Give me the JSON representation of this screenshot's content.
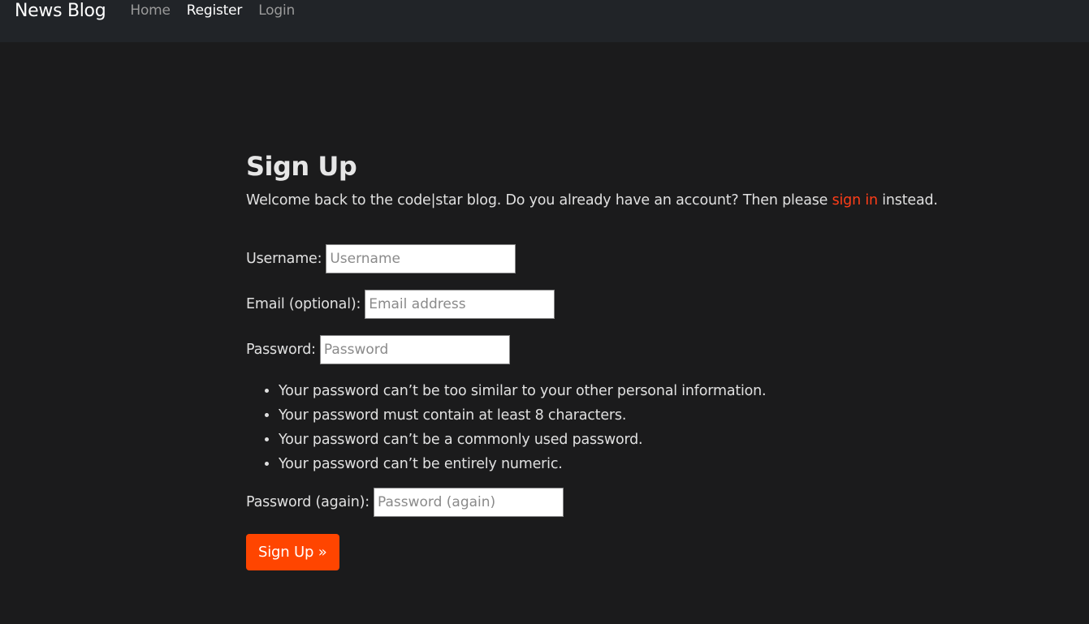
{
  "navbar": {
    "brand": "News Blog",
    "links": [
      {
        "label": "Home"
      },
      {
        "label": "Register"
      },
      {
        "label": "Login"
      }
    ]
  },
  "page": {
    "title": "Sign Up",
    "intro_before": "Welcome back to the code|star blog. Do you already have an account? Then please ",
    "intro_link": "sign in",
    "intro_after": " instead."
  },
  "form": {
    "username": {
      "label": "Username:",
      "placeholder": "Username",
      "value": ""
    },
    "email": {
      "label": "Email (optional):",
      "placeholder": "Email address",
      "value": ""
    },
    "password": {
      "label": "Password:",
      "placeholder": "Password",
      "value": ""
    },
    "password_help": [
      "Your password can’t be too similar to your other personal information.",
      "Your password must contain at least 8 characters.",
      "Your password can’t be a commonly used password.",
      "Your password can’t be entirely numeric."
    ],
    "password2": {
      "label": "Password (again):",
      "placeholder": "Password (again)",
      "value": ""
    },
    "submit_label": "Sign Up »"
  },
  "colors": {
    "background": "#1b1b1c",
    "navbar": "#212428",
    "accent": "#ff4500",
    "link": "#ff3d18"
  }
}
